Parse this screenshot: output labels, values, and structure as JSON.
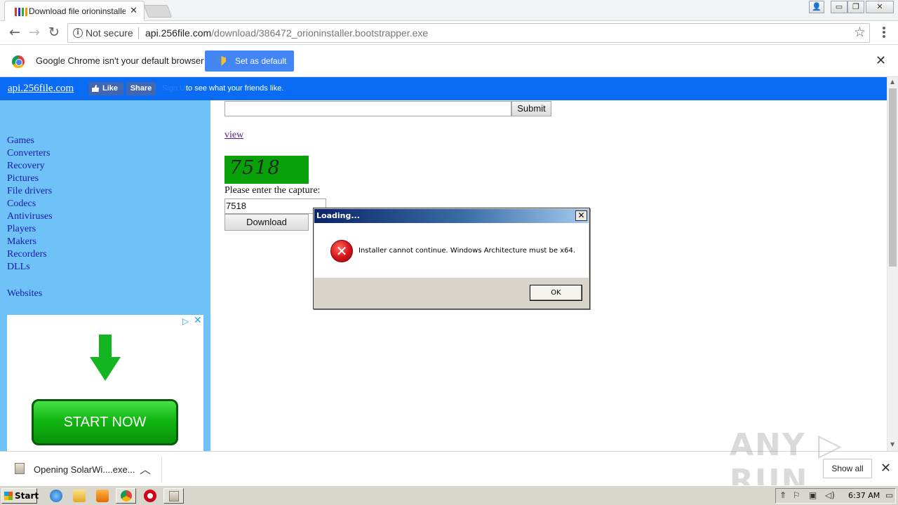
{
  "browser": {
    "tab": {
      "title": "Download file orioninstaller.bootstrapper.exe",
      "close": "✕"
    },
    "window_buttons": {
      "user": "👤",
      "minimize": "▭",
      "restore": "❐",
      "close": "✕"
    },
    "nav": {
      "back": "←",
      "forward": "→",
      "reload": "↻"
    },
    "omnibox": {
      "security_label": "Not secure",
      "url_host": "api.256file.com",
      "url_path": "/download/386472_orioninstaller.bootstrapper.exe",
      "star": "☆"
    },
    "infobar": {
      "message": "Google Chrome isn't your default browser",
      "button_label": "Set as default",
      "close": "✕"
    }
  },
  "site": {
    "header": {
      "site_link": "api.256file.com",
      "fb_like": "Like",
      "fb_share": "Share",
      "fb_signup": "Sign Up",
      "fb_text": "to see what your friends like."
    },
    "sidebar": {
      "links": [
        "Games",
        "Converters",
        "Recovery",
        "Pictures",
        "File drivers",
        "Codecs",
        "Antiviruses",
        "Players",
        "Makers",
        "Recorders",
        "DLLs"
      ],
      "websites": "Websites"
    },
    "ad": {
      "adchoices": "▷",
      "close": "✕",
      "button_label": "START NOW"
    },
    "form": {
      "submit_label": "Submit",
      "view_link": "view",
      "captcha_code": "7518",
      "captcha_label": "Please enter the capture:",
      "captcha_value": "7518",
      "download_label": "Download"
    }
  },
  "dialog": {
    "title": "Loading...",
    "close": "✕",
    "message": "Installer cannot continue. Windows Architecture must be x64.",
    "error_glyph": "✕",
    "ok_label": "OK"
  },
  "downloads_bar": {
    "item_label": "Opening SolarWi....exe...",
    "chevron": "︿",
    "show_all": "Show all",
    "close": "✕",
    "watermark": "ANY ▷ RUN"
  },
  "taskbar": {
    "start_label": "Start",
    "clock": "6:37 AM",
    "tray_expand": "⇑"
  },
  "colors": {
    "site_header": "#0a6cf5",
    "sidebar": "#6ec2f8",
    "captcha_bg": "#0aa00a",
    "infobar_button": "#4285f4"
  }
}
